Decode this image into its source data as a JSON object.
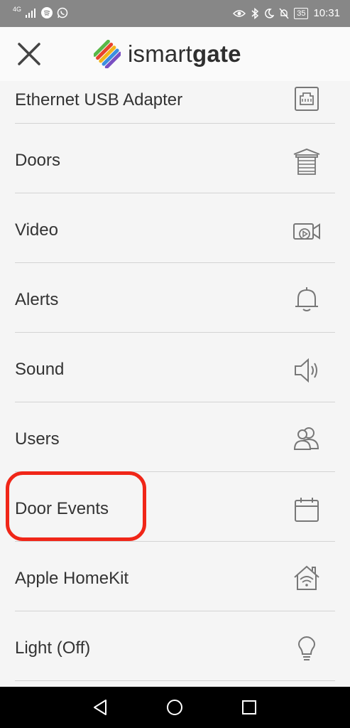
{
  "status_bar": {
    "network": "4G",
    "battery": "35",
    "time": "10:31"
  },
  "header": {
    "logo_text_regular": "ismart",
    "logo_text_bold": "gate"
  },
  "menu": {
    "items": [
      {
        "label": "Ethernet USB Adapter",
        "icon": "ethernet-port-icon"
      },
      {
        "label": "Doors",
        "icon": "garage-door-icon"
      },
      {
        "label": "Video",
        "icon": "video-camera-icon"
      },
      {
        "label": "Alerts",
        "icon": "bell-icon"
      },
      {
        "label": "Sound",
        "icon": "speaker-icon"
      },
      {
        "label": "Users",
        "icon": "users-icon"
      },
      {
        "label": "Door Events",
        "icon": "calendar-icon"
      },
      {
        "label": "Apple HomeKit",
        "icon": "homekit-house-icon"
      },
      {
        "label": "Light (Off)",
        "icon": "light-bulb-icon"
      }
    ]
  },
  "colors": {
    "highlight": "#f02618",
    "status_bar_bg": "#878787",
    "text": "#333333"
  }
}
